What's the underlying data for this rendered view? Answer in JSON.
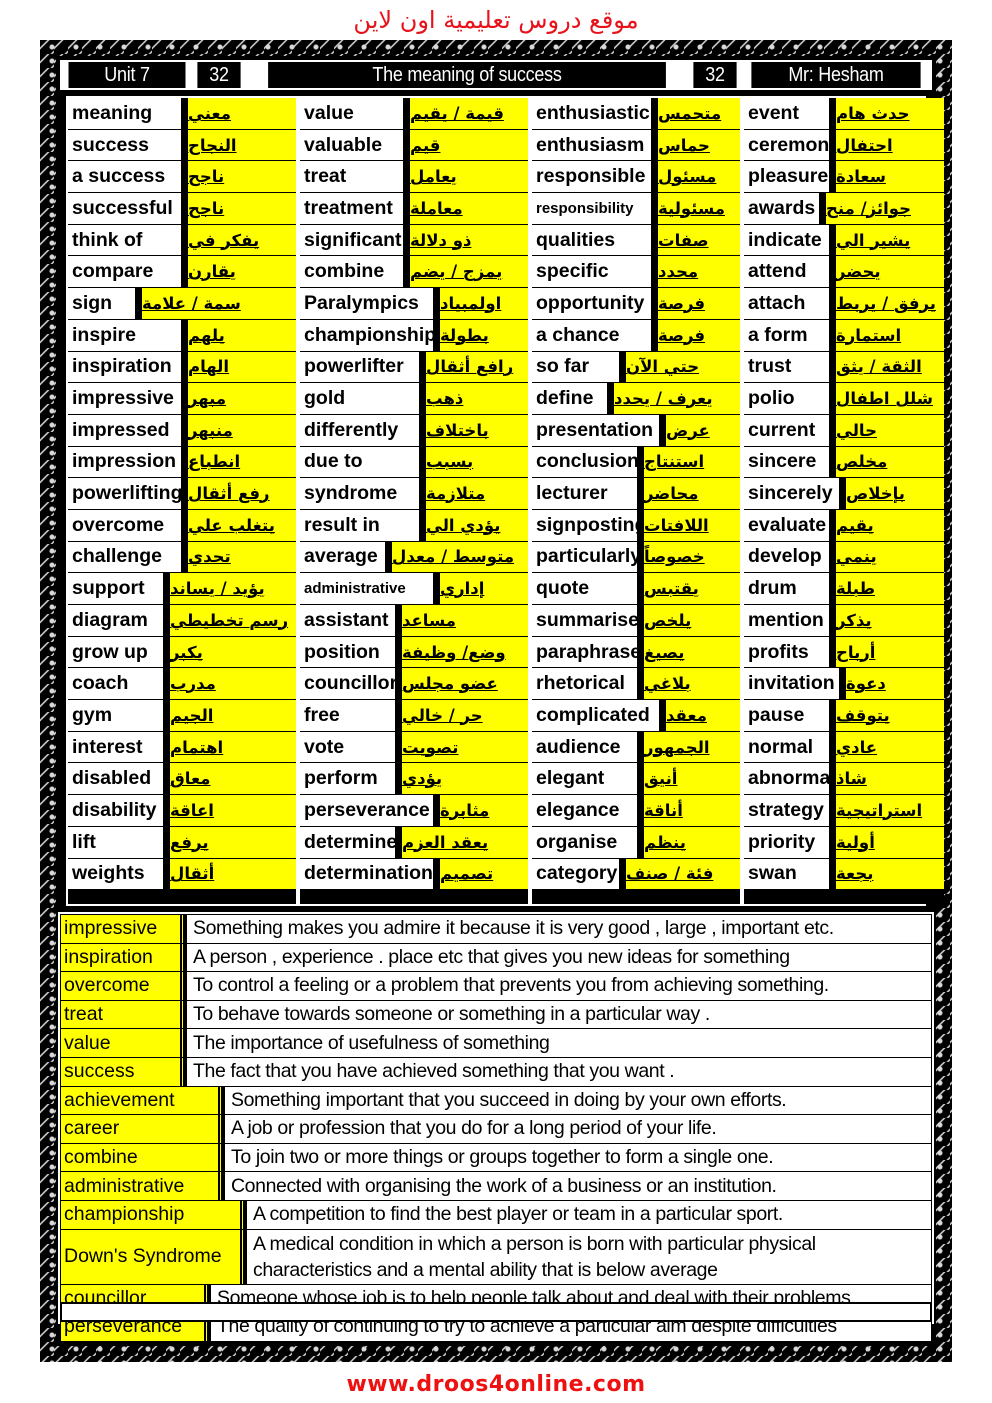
{
  "site_title": "موقع دروس تعليمية اون لاين",
  "header": {
    "unit": "Unit 7",
    "page_left": "32",
    "title": "The meaning of success",
    "page_right": "32",
    "teacher": "Mr: Hesham"
  },
  "vocabulary": [
    [
      {
        "en": "meaning",
        "ar": "معني"
      },
      {
        "en": "success",
        "ar": "النجاح"
      },
      {
        "en": "a success",
        "ar": "ناجح"
      },
      {
        "en": "successful",
        "ar": "ناجح"
      },
      {
        "en": "think of",
        "ar": "يفكر في"
      },
      {
        "en": "compare",
        "ar": "يقارن"
      },
      {
        "en": "sign",
        "ar": "سمة / علامة"
      },
      {
        "en": "inspire",
        "ar": "يلهم"
      },
      {
        "en": "inspiration",
        "ar": "الهام"
      },
      {
        "en": "impressive",
        "ar": "مبهر"
      },
      {
        "en": "impressed",
        "ar": "منبهر"
      },
      {
        "en": "impression",
        "ar": "انطباع"
      },
      {
        "en": "powerlifting",
        "ar": "رفع أثقال"
      },
      {
        "en": "overcome",
        "ar": "يتغلب علي"
      },
      {
        "en": "challenge",
        "ar": "تحدي"
      },
      {
        "en": "support",
        "ar": "يؤيد / يساند"
      },
      {
        "en": "diagram",
        "ar": "رسم تخطيطي"
      },
      {
        "en": "grow up",
        "ar": "يكبر"
      },
      {
        "en": "coach",
        "ar": "مدرب"
      },
      {
        "en": "gym",
        "ar": "الجيم"
      },
      {
        "en": "interest",
        "ar": "اهتمام"
      },
      {
        "en": "disabled",
        "ar": "معاق"
      },
      {
        "en": "disability",
        "ar": "اعاقة"
      },
      {
        "en": "lift",
        "ar": "يرفع"
      },
      {
        "en": "weights",
        "ar": "أثقال"
      }
    ],
    [
      {
        "en": "value",
        "ar": "قيمة / يقيم"
      },
      {
        "en": "valuable",
        "ar": "قيم"
      },
      {
        "en": "treat",
        "ar": "يعامل"
      },
      {
        "en": "treatment",
        "ar": "معاملة"
      },
      {
        "en": "significant",
        "ar": "ذو دلالة"
      },
      {
        "en": "combine",
        "ar": "يمزج / يضم"
      },
      {
        "en": "Paralympics",
        "ar": "اولمبياد"
      },
      {
        "en": "championship",
        "ar": "بطولة"
      },
      {
        "en": "powerlifter",
        "ar": "رافع أثقال"
      },
      {
        "en": "gold",
        "ar": "ذهب"
      },
      {
        "en": "differently",
        "ar": "باختلاف"
      },
      {
        "en": "due to",
        "ar": "بسبب"
      },
      {
        "en": "syndrome",
        "ar": "متلازمة"
      },
      {
        "en": "result in",
        "ar": "يؤدي الي"
      },
      {
        "en": "average",
        "ar": "متوسط / معدل"
      },
      {
        "en": "administrative",
        "ar": "إداري"
      },
      {
        "en": "assistant",
        "ar": "مساعد"
      },
      {
        "en": "position",
        "ar": "وضع/ وظيفة"
      },
      {
        "en": "councillor",
        "ar": "عضو مجلس"
      },
      {
        "en": "free",
        "ar": "حر / خالي"
      },
      {
        "en": "vote",
        "ar": "تصويت"
      },
      {
        "en": "perform",
        "ar": "يؤدي"
      },
      {
        "en": "perseverance",
        "ar": "مثابرة"
      },
      {
        "en": "determine",
        "ar": "يعقد العزم"
      },
      {
        "en": "determination",
        "ar": "تصميم"
      }
    ],
    [
      {
        "en": "enthusiastic",
        "ar": "متحمس"
      },
      {
        "en": "enthusiasm",
        "ar": "حماس"
      },
      {
        "en": "responsible",
        "ar": "مسئول"
      },
      {
        "en": "responsibility",
        "ar": "مسئولية"
      },
      {
        "en": "qualities",
        "ar": "صفات"
      },
      {
        "en": "specific",
        "ar": "محدد"
      },
      {
        "en": "opportunity",
        "ar": "فرصة"
      },
      {
        "en": "a chance",
        "ar": "فرصة"
      },
      {
        "en": "so far",
        "ar": "حتي الآن"
      },
      {
        "en": "define",
        "ar": "يعرف / يحدد"
      },
      {
        "en": "presentation",
        "ar": "عرض"
      },
      {
        "en": "conclusion",
        "ar": "استنتاج"
      },
      {
        "en": "lecturer",
        "ar": "محاضر"
      },
      {
        "en": "signposting",
        "ar": "اللافتات"
      },
      {
        "en": "particularly",
        "ar": "خصوصاً"
      },
      {
        "en": "quote",
        "ar": "يقتبس"
      },
      {
        "en": "summarise",
        "ar": "يلخص"
      },
      {
        "en": "paraphrase",
        "ar": "يصيغ"
      },
      {
        "en": "rhetorical",
        "ar": "بلاغي"
      },
      {
        "en": "complicated",
        "ar": "معقد"
      },
      {
        "en": "audience",
        "ar": "الجمهور"
      },
      {
        "en": "elegant",
        "ar": "أنيق"
      },
      {
        "en": "elegance",
        "ar": "أناقة"
      },
      {
        "en": "organise",
        "ar": "ينظم"
      },
      {
        "en": "category",
        "ar": "فئة / صنف"
      }
    ],
    [
      {
        "en": "event",
        "ar": "حدث هام"
      },
      {
        "en": "ceremony",
        "ar": "احتفال"
      },
      {
        "en": "pleasure",
        "ar": "سعادة"
      },
      {
        "en": "awards",
        "ar": "جوائز/ منح"
      },
      {
        "en": "indicate",
        "ar": "يشير الي"
      },
      {
        "en": "attend",
        "ar": "يحضر"
      },
      {
        "en": "attach",
        "ar": "يرفق / يربط"
      },
      {
        "en": "a form",
        "ar": "استمارة"
      },
      {
        "en": "trust",
        "ar": "الثقة / يثق"
      },
      {
        "en": "polio",
        "ar": "شلل اطفال"
      },
      {
        "en": "current",
        "ar": "حالي"
      },
      {
        "en": "sincere",
        "ar": "مخلص"
      },
      {
        "en": "sincerely",
        "ar": "بإخلاص"
      },
      {
        "en": "evaluate",
        "ar": "يقيم"
      },
      {
        "en": "develop",
        "ar": "ينمي"
      },
      {
        "en": "drum",
        "ar": "طبلة"
      },
      {
        "en": "mention",
        "ar": "يذكر"
      },
      {
        "en": "profits",
        "ar": "أرباح"
      },
      {
        "en": "invitation",
        "ar": "دعوة"
      },
      {
        "en": "pause",
        "ar": "يتوقف"
      },
      {
        "en": "normal",
        "ar": "عادي"
      },
      {
        "en": "abnormal",
        "ar": "شاذ"
      },
      {
        "en": "strategy",
        "ar": "استراتيجية"
      },
      {
        "en": "priority",
        "ar": "أولية"
      },
      {
        "en": "swan",
        "ar": "بجعة"
      }
    ]
  ],
  "definitions": [
    {
      "term": "impressive",
      "definition": "Something makes you admire it because it is very good , large , important etc."
    },
    {
      "term": "inspiration",
      "definition": "A person , experience . place etc that gives you new ideas for something"
    },
    {
      "term": "overcome",
      "definition": "To control a feeling or a problem that prevents you from achieving something."
    },
    {
      "term": "treat",
      "definition": "To behave towards someone or something in a particular way ."
    },
    {
      "term": "value",
      "definition": "The importance of usefulness of something"
    },
    {
      "term": "success",
      "definition": "The fact that you have achieved something that you want ."
    },
    {
      "term": "achievement",
      "definition": "Something important that you succeed in doing by your own efforts."
    },
    {
      "term": "career",
      "definition": "A job or profession that you do for a long period of your life."
    },
    {
      "term": "combine",
      "definition": "To join two or more things or groups together to form a single one."
    },
    {
      "term": "administrative",
      "definition": "Connected with organising the work of a business or an institution."
    },
    {
      "term": "championship",
      "definition": "A competition to find the best player or team in a particular sport."
    },
    {
      "term": "Down's Syndrome",
      "definition": "A medical condition in which a person is born with  particular physical characteristics and a mental ability that is below average"
    },
    {
      "term": "councillor",
      "definition": "Someone whose job is to help people talk about and deal with their problems."
    },
    {
      "term": "perseverance",
      "definition": "The quality of continuing to try to achieve a particular aim despite difficulties"
    }
  ],
  "footer_url": "www.droos4online.com",
  "colors": {
    "highlight": "#ffff00",
    "brand_red": "#e8121b",
    "frame": "#000000"
  }
}
